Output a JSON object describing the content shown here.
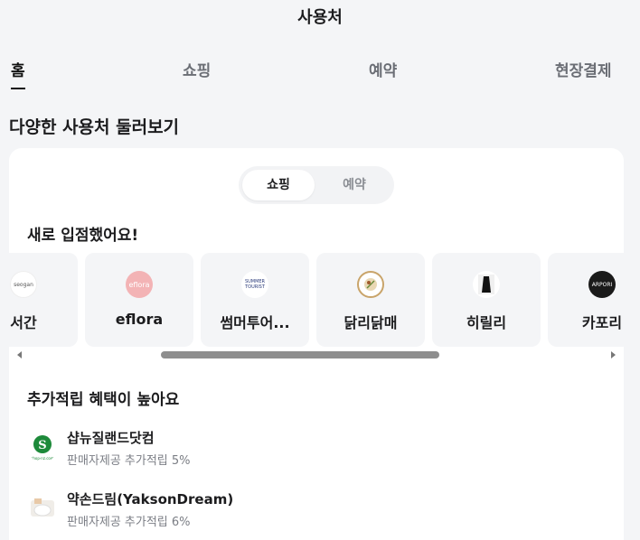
{
  "header": {
    "title": "사용처"
  },
  "tabs": [
    {
      "label": "홈",
      "active": true
    },
    {
      "label": "쇼핑",
      "active": false
    },
    {
      "label": "예약",
      "active": false
    },
    {
      "label": "현장결제",
      "active": false
    }
  ],
  "section_title": "다양한 사용처 둘러보기",
  "toggle": {
    "options": [
      "쇼핑",
      "예약"
    ],
    "selected": "쇼핑"
  },
  "new_stores": {
    "title": "새로 입점했어요!",
    "items": [
      {
        "name": "서간",
        "logo_text": "seogan",
        "icon": "seogan-logo-icon"
      },
      {
        "name": "eflora",
        "logo_text": "eflora",
        "icon": "eflora-logo-icon"
      },
      {
        "name": "썸머투어...",
        "logo_text": "SUMMER TOURIST",
        "icon": "summer-tourist-logo-icon"
      },
      {
        "name": "닭리닭매",
        "logo_text": "",
        "icon": "chicken-logo-icon"
      },
      {
        "name": "히릴리",
        "logo_text": "",
        "icon": "dress-logo-icon"
      },
      {
        "name": "카포리",
        "logo_text": "ARPORI",
        "icon": "capori-logo-icon"
      }
    ]
  },
  "bonus": {
    "title": "추가적립 혜택이 높아요",
    "items": [
      {
        "name": "샵뉴질랜드닷컴",
        "desc": "판매자제공 추가적립 5%",
        "logo_text": "shop-nz.com"
      },
      {
        "name": "약손드림(YaksonDream)",
        "desc": "판매자제공 추가적립 6%",
        "logo_text": ""
      }
    ]
  },
  "colors": {
    "background": "#f4f5f7",
    "card": "#ffffff",
    "text": "#1c1c1e",
    "muted": "#7b7e85"
  }
}
